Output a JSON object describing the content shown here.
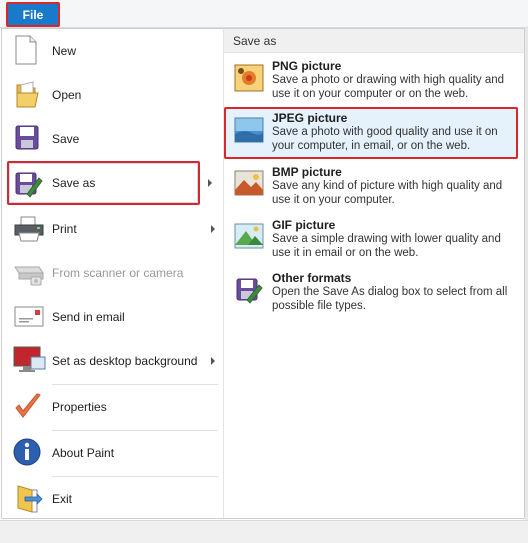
{
  "file_tab": {
    "label": "File"
  },
  "left_menu": {
    "items": [
      {
        "id": "new",
        "label": "New",
        "icon": "new-file-icon",
        "enabled": true,
        "submenu": false
      },
      {
        "id": "open",
        "label": "Open",
        "icon": "open-folder-icon",
        "enabled": true,
        "submenu": false
      },
      {
        "id": "save",
        "label": "Save",
        "icon": "save-disk-icon",
        "enabled": true,
        "submenu": false
      },
      {
        "id": "save_as",
        "label": "Save as",
        "icon": "save-as-icon",
        "enabled": true,
        "submenu": true
      },
      {
        "id": "print",
        "label": "Print",
        "icon": "printer-icon",
        "enabled": true,
        "submenu": true
      },
      {
        "id": "scanner",
        "label": "From scanner or camera",
        "icon": "scanner-icon",
        "enabled": false,
        "submenu": false
      },
      {
        "id": "email",
        "label": "Send in email",
        "icon": "email-icon",
        "enabled": true,
        "submenu": false
      },
      {
        "id": "desktop_bg",
        "label": "Set as desktop background",
        "icon": "desktop-background-icon",
        "enabled": true,
        "submenu": true
      },
      {
        "id": "properties",
        "label": "Properties",
        "icon": "properties-check-icon",
        "enabled": true,
        "submenu": false
      },
      {
        "id": "about",
        "label": "About Paint",
        "icon": "info-icon",
        "enabled": true,
        "submenu": false
      },
      {
        "id": "exit",
        "label": "Exit",
        "icon": "exit-icon",
        "enabled": true,
        "submenu": false
      }
    ]
  },
  "save_as_submenu": {
    "heading": "Save as",
    "items": [
      {
        "id": "png",
        "title": "PNG picture",
        "desc": "Save a photo or drawing with high quality and use it on your computer or on the web.",
        "icon": "png-picture-icon"
      },
      {
        "id": "jpeg",
        "title": "JPEG picture",
        "desc": "Save a photo with good quality and use it on your computer, in email, or on the web.",
        "icon": "jpeg-picture-icon"
      },
      {
        "id": "bmp",
        "title": "BMP picture",
        "desc": "Save any kind of picture with high quality and use it on your computer.",
        "icon": "bmp-picture-icon"
      },
      {
        "id": "gif",
        "title": "GIF picture",
        "desc": "Save a simple drawing with lower quality and use it in email or on the web.",
        "icon": "gif-picture-icon"
      },
      {
        "id": "other",
        "title": "Other formats",
        "desc": "Open the Save As dialog box to select from all possible file types.",
        "icon": "other-formats-icon"
      }
    ]
  },
  "colors": {
    "file_tab_bg": "#1979ca",
    "highlight_border": "#d9262b",
    "hover_bg": "#e5f1fb"
  }
}
